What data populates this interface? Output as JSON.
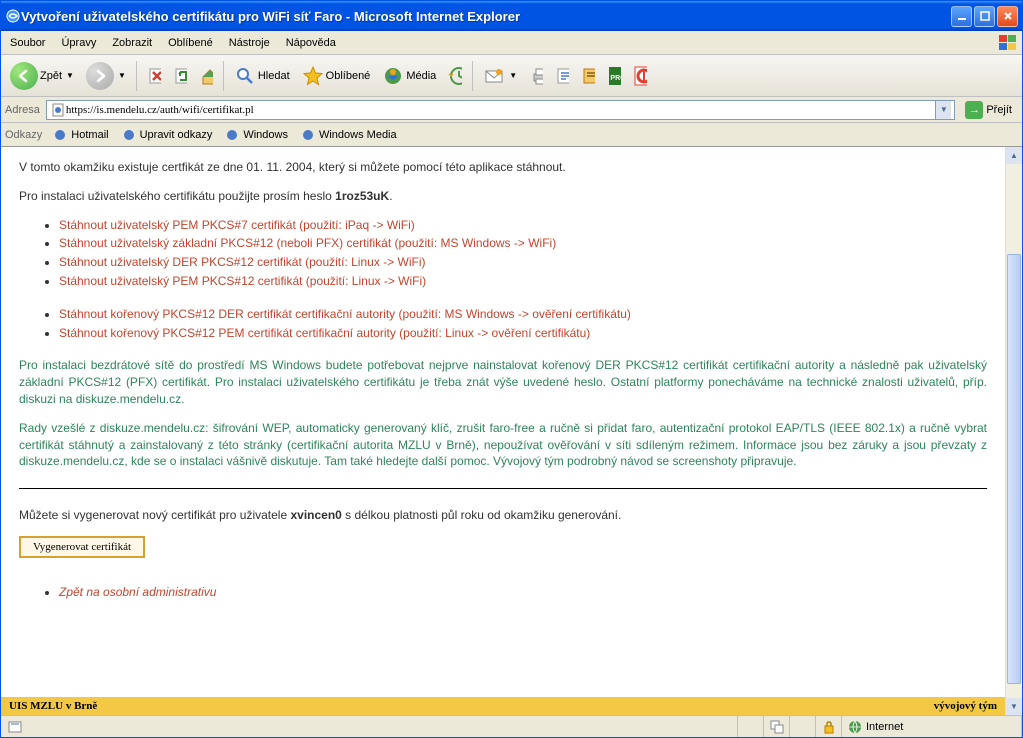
{
  "window": {
    "title": "Vytvoření uživatelského certifikátu pro WiFi síť Faro - Microsoft Internet Explorer"
  },
  "menu": {
    "items": [
      "Soubor",
      "Úpravy",
      "Zobrazit",
      "Oblíbené",
      "Nástroje",
      "Nápověda"
    ]
  },
  "toolbar": {
    "back": "Zpět",
    "search": "Hledat",
    "favorites": "Oblíbené",
    "media": "Média"
  },
  "address": {
    "label": "Adresa",
    "url": "https://is.mendelu.cz/auth/wifi/certifikat.pl",
    "go": "Přejít"
  },
  "linksbar": {
    "label": "Odkazy",
    "items": [
      "Hotmail",
      "Upravit odkazy",
      "Windows",
      "Windows Media"
    ]
  },
  "content": {
    "line1_pre": "V tomto okamžiku existuje certfikát ze dne 01. 11. 2004, který si můžete pomocí této aplikace stáhnout.",
    "line2_pre": "Pro instalaci uživatelského certifikátu použijte prosím heslo ",
    "password": "1roz53uK",
    "line2_post": ".",
    "links1": [
      "Stáhnout uživatelský PEM PKCS#7 certifikát (použití: iPaq -> WiFi)",
      "Stáhnout uživatelský základní PKCS#12 (neboli PFX) certifikát (použití: MS Windows -> WiFi)",
      "Stáhnout uživatelský DER PKCS#12 certifikát (použití: Linux -> WiFi)",
      "Stáhnout uživatelský PEM PKCS#12 certifikát (použití: Linux -> WiFi)"
    ],
    "links2": [
      "Stáhnout kořenový PKCS#12 DER certifikát certifikační autority (použití: MS Windows -> ověření certifikátu)",
      "Stáhnout kořenový PKCS#12 PEM certifikát certifikační autority (použití: Linux -> ověření certifikátu)"
    ],
    "green1": "Pro instalaci bezdrátové sítě do prostředí MS Windows budete potřebovat nejprve nainstalovat kořenový DER PKCS#12 certifikát certifikační autority a následně pak uživatelský základní PKCS#12 (PFX) certifikát. Pro instalaci uživatelského certifikátu je třeba znát výše uvedené heslo. Ostatní platformy ponecháváme na technické znalosti uživatelů, příp. diskuzi na diskuze.mendelu.cz.",
    "green2": "Rady vzešlé z diskuze.mendelu.cz: šifrování WEP, automaticky generovaný klíč, zrušit faro-free a ručně si přidat faro, autentizační protokol EAP/TLS (IEEE 802.1x) a ručně vybrat certifikát stáhnutý a zainstalovaný z této stránky (certifikační autorita MZLU v Brně), nepoužívat ověřování v síti sdíleným režimem. Informace jsou bez záruky a jsou převzaty z diskuze.mendelu.cz, kde se o instalaci vášnivě diskutuje. Tam také hledejte další pomoc. Vývojový tým podrobný návod se screenshoty připravuje.",
    "gen_pre": "Můžete si vygenerovat nový certifikát pro uživatele ",
    "gen_user": "xvincen0",
    "gen_post": " s délkou platnosti půl roku od okamžiku generování.",
    "gen_button": "Vygenerovat certifikát",
    "back_link": "Zpět na osobní administrativu"
  },
  "footer": {
    "left": "UIS MZLU v Brně",
    "right": "vývojový tým"
  },
  "status": {
    "zone": "Internet"
  }
}
